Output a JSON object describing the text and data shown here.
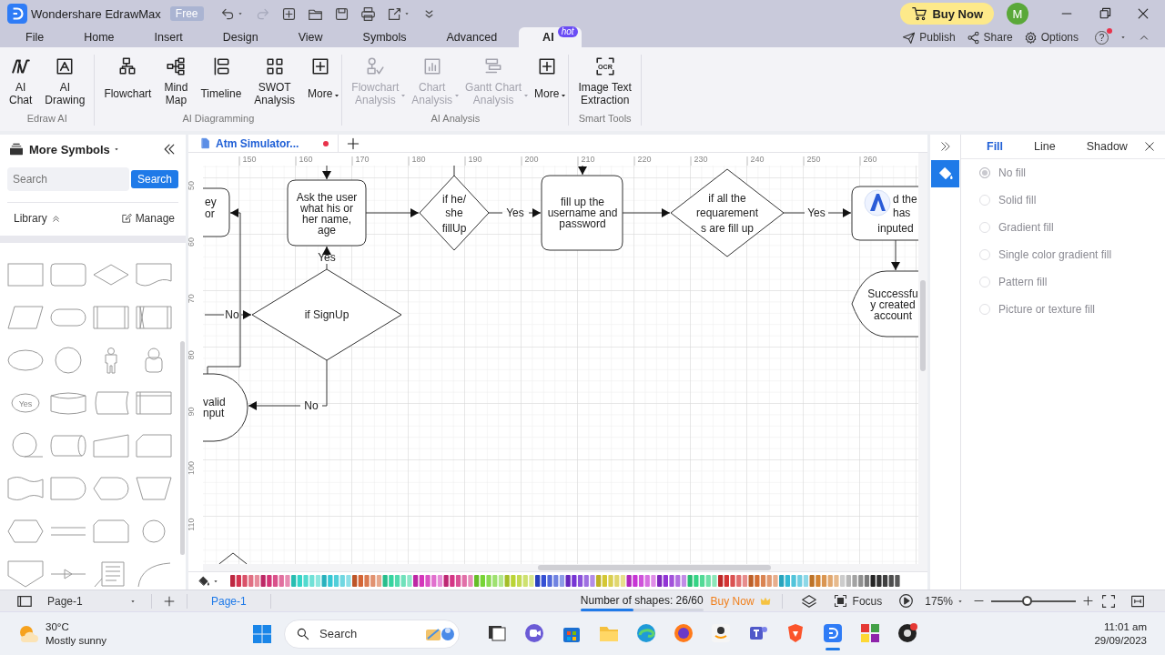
{
  "title_bar": {
    "app_name": "Wondershare EdrawMax",
    "plan_badge": "Free",
    "buy_button": "Buy Now",
    "avatar": "M"
  },
  "quick_access": [
    {
      "kind": "undo",
      "disabled": false,
      "dropdown": true
    },
    {
      "kind": "redo",
      "disabled": true,
      "dropdown": false
    },
    {
      "kind": "new-page",
      "disabled": false,
      "dropdown": false
    },
    {
      "kind": "folder",
      "disabled": false,
      "dropdown": false
    },
    {
      "kind": "save",
      "disabled": false,
      "dropdown": false
    },
    {
      "kind": "print",
      "disabled": false,
      "dropdown": false
    },
    {
      "kind": "export",
      "disabled": false,
      "dropdown": true
    },
    {
      "kind": "customize",
      "disabled": false,
      "dropdown": false
    }
  ],
  "menu_tabs": [
    {
      "label": "File",
      "selected": false
    },
    {
      "label": "Home",
      "selected": false
    },
    {
      "label": "Insert",
      "selected": false
    },
    {
      "label": "Design",
      "selected": false
    },
    {
      "label": "View",
      "selected": false
    },
    {
      "label": "Symbols",
      "selected": false
    },
    {
      "label": "Advanced",
      "selected": false
    },
    {
      "label": "AI",
      "selected": true,
      "badge": "hot"
    }
  ],
  "header_actions": [
    {
      "kind": "publish",
      "label": "Publish"
    },
    {
      "kind": "share",
      "label": "Share"
    },
    {
      "kind": "options",
      "label": "Options"
    }
  ],
  "help": {
    "label": "?",
    "notification": true
  },
  "ribbon_groups": [
    {
      "title": "Edraw AI",
      "buttons": [
        {
          "kind": "ai-chat",
          "lines": [
            "AI",
            "Chat"
          ],
          "disabled": false,
          "dropdown": false
        },
        {
          "kind": "ai-drawing",
          "lines": [
            "AI",
            "Drawing"
          ],
          "disabled": false,
          "dropdown": false
        }
      ]
    },
    {
      "title": "AI Diagramming",
      "buttons": [
        {
          "kind": "flowchart",
          "lines": [
            "Flowchart"
          ],
          "disabled": false,
          "dropdown": false
        },
        {
          "kind": "mind-map",
          "lines": [
            "Mind",
            "Map"
          ],
          "disabled": false,
          "dropdown": false
        },
        {
          "kind": "timeline",
          "lines": [
            "Timeline"
          ],
          "disabled": false,
          "dropdown": false
        },
        {
          "kind": "swot",
          "lines": [
            "SWOT",
            "Analysis"
          ],
          "disabled": false,
          "dropdown": false
        },
        {
          "kind": "more",
          "lines": [
            "More"
          ],
          "disabled": false,
          "dropdown": true
        }
      ]
    },
    {
      "title": "AI Analysis",
      "buttons": [
        {
          "kind": "flowchart-analysis",
          "lines": [
            "Flowchart",
            "Analysis"
          ],
          "disabled": true,
          "dropdown": true
        },
        {
          "kind": "chart-analysis",
          "lines": [
            "Chart",
            "Analysis"
          ],
          "disabled": true,
          "dropdown": true
        },
        {
          "kind": "gantt-analysis",
          "lines": [
            "Gantt Chart",
            "Analysis"
          ],
          "disabled": true,
          "dropdown": true
        },
        {
          "kind": "more",
          "lines": [
            "More"
          ],
          "disabled": false,
          "dropdown": true
        }
      ]
    },
    {
      "title": "Smart Tools",
      "buttons": [
        {
          "kind": "ocr",
          "icon_text": "OCR",
          "lines": [
            "Image Text",
            "Extraction"
          ],
          "disabled": false,
          "dropdown": false
        }
      ]
    }
  ],
  "left_panel": {
    "title": "More Symbols",
    "search_placeholder": "Search",
    "search_button": "Search",
    "library_label": "Library",
    "manage_label": "Manage",
    "symbol_text": "Yes"
  },
  "document_tab": {
    "title": "Atm Simulator...",
    "unsaved": true
  },
  "ruler": {
    "x_marks": [
      "150",
      "160",
      "170",
      "180",
      "190",
      "200",
      "210",
      "220",
      "230",
      "240",
      "250",
      "260"
    ],
    "y_marks": [
      "50",
      "60",
      "70",
      "80",
      "90",
      "100",
      "110"
    ]
  },
  "diagram": {
    "nodes": [
      {
        "kind": "rounded",
        "lines": [
          "ey",
          "or"
        ]
      },
      {
        "kind": "rounded",
        "lines": [
          "Ask the user",
          "what his or",
          "her name,",
          "age"
        ]
      },
      {
        "kind": "diamond",
        "lines": [
          "if he/",
          "she",
          "fillUp"
        ]
      },
      {
        "kind": "rounded",
        "lines": [
          "fill up the",
          "username and",
          "password"
        ]
      },
      {
        "kind": "diamond",
        "lines": [
          "if all the",
          "requarement",
          "s are fill up"
        ]
      },
      {
        "kind": "rounded",
        "lines": [
          "d the",
          "has",
          "inputed"
        ]
      },
      {
        "kind": "diamond",
        "lines": [
          "if SignUp"
        ]
      },
      {
        "kind": "display",
        "lines": [
          "Successfu",
          "y created",
          "account"
        ]
      },
      {
        "kind": "delay",
        "lines": [
          "valid",
          "nput"
        ]
      },
      {
        "kind": "diamond"
      }
    ],
    "labels": [
      "Yes",
      "Yes",
      "Yes",
      "No",
      "No"
    ]
  },
  "right_panel": {
    "tools": [
      {
        "kind": "fill",
        "selected": true
      }
    ],
    "tabs": [
      {
        "label": "Fill",
        "selected": true
      },
      {
        "label": "Line",
        "selected": false
      },
      {
        "label": "Shadow",
        "selected": false
      }
    ],
    "fill_options": [
      {
        "label": "No fill",
        "selected": true
      },
      {
        "label": "Solid fill",
        "selected": false
      },
      {
        "label": "Gradient fill",
        "selected": false
      },
      {
        "label": "Single color gradient fill",
        "selected": false
      },
      {
        "label": "Pattern fill",
        "selected": false
      },
      {
        "label": "Picture or texture fill",
        "selected": false
      }
    ]
  },
  "status_bar": {
    "page_dropdown": "Page-1",
    "page_tabs": [
      {
        "label": "Page-1",
        "selected": true
      }
    ],
    "shape_count": "Number of shapes: 26/60",
    "shape_usage": {
      "level": 0.433
    },
    "buy_link": "Buy Now",
    "focus_label": "Focus",
    "zoom": "175%",
    "zoom_slider": {
      "level": 0.42
    }
  },
  "taskbar": {
    "temperature": "30°C",
    "weather": "Mostly sunny",
    "search_placeholder": "Search",
    "time": "11:01 am",
    "date": "29/09/2023",
    "apps": [
      {
        "kind": "task-view",
        "selected": false
      },
      {
        "kind": "video-chat",
        "selected": false
      },
      {
        "kind": "store",
        "selected": false
      },
      {
        "kind": "file-folder",
        "selected": false
      },
      {
        "kind": "browser",
        "selected": false
      },
      {
        "kind": "globe",
        "selected": false
      },
      {
        "kind": "shopping",
        "selected": false
      },
      {
        "kind": "team",
        "selected": false
      },
      {
        "kind": "lion-shield",
        "selected": false
      },
      {
        "kind": "diagram-app",
        "selected": true
      },
      {
        "kind": "grid-app",
        "selected": false
      },
      {
        "kind": "record-app",
        "selected": false
      }
    ]
  }
}
